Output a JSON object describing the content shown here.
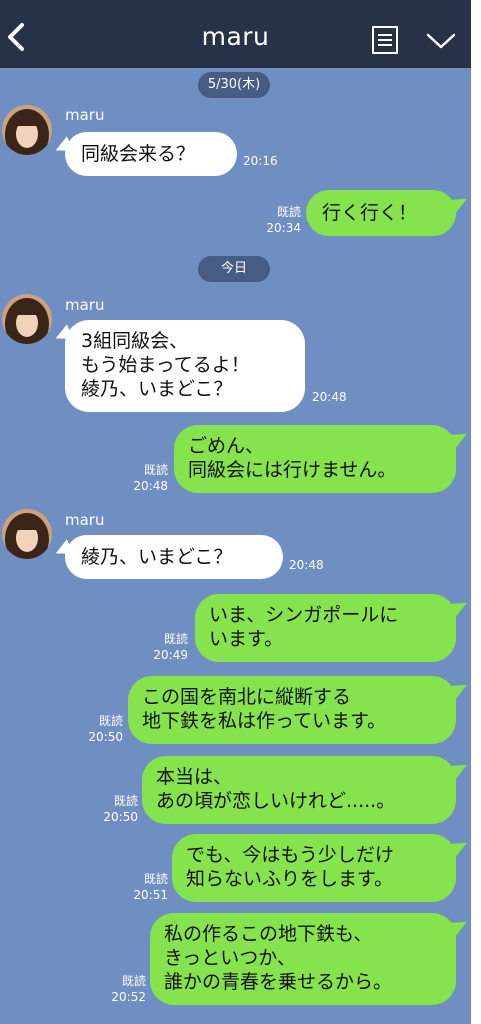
{
  "header": {
    "title": "maru"
  },
  "dates": {
    "first": "5/30(木)",
    "today": "今日"
  },
  "messages": [
    {
      "from": "maru",
      "text": "同級会来る？",
      "time": "20:16"
    },
    {
      "read": "既読",
      "text": "行く行く！",
      "time": "20:34"
    },
    {
      "from": "maru",
      "text": "3組同級会、\nもう始まってるよ！\n綾乃、いまどこ？",
      "time": "20:48"
    },
    {
      "read": "既読",
      "text": "ごめん、\n同級会には行けません。",
      "time": "20:48"
    },
    {
      "from": "maru",
      "text": "綾乃、いまどこ？",
      "time": "20:48"
    },
    {
      "read": "既読",
      "text": "いま、シンガポールに\nいます。",
      "time": "20:49"
    },
    {
      "read": "既読",
      "text": "この国を南北に縦断する\n地下鉄を私は作っています。",
      "time": "20:50"
    },
    {
      "read": "既読",
      "text": "本当は、\nあの頃が恋しいけれど.....。",
      "time": "20:50"
    },
    {
      "read": "既読",
      "text": "でも、今はもう少しだけ\n知らないふりをします。",
      "time": "20:51"
    },
    {
      "read": "既読",
      "text": "私の作るこの地下鉄も、\nきっといつか、\n誰かの青春を乗せるから。",
      "time": "20:52"
    }
  ],
  "colors": {
    "background": "#6f8fc2",
    "header": "#273147",
    "outgoing": "#86e34d",
    "incoming": "#ffffff",
    "pill": "#465c82"
  },
  "icons": {
    "back": "chevron-left-icon",
    "menu": "notes-icon",
    "collapse": "chevron-down-icon"
  }
}
